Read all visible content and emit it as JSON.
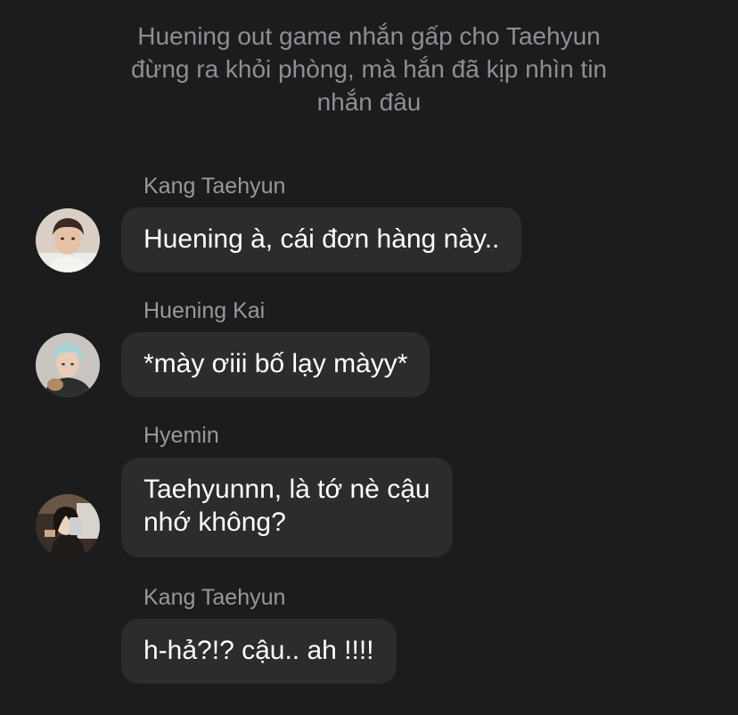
{
  "system_note": {
    "lines": [
      "Huening out game nhắn gấp cho Taehyun",
      "đừng ra khỏi phòng, mà hắn đã kịp nhìn tin",
      "nhắn đâu"
    ]
  },
  "messages": [
    {
      "sender": "Kang Taehyun",
      "avatar": "avatar-kang-taehyun",
      "lines": [
        "Huening à, cái đơn hàng này.."
      ]
    },
    {
      "sender": "Huening Kai",
      "avatar": "avatar-huening-kai",
      "lines": [
        "*mày ơiii bố lạy màyy*"
      ]
    },
    {
      "sender": "Hyemin",
      "avatar": "avatar-hyemin",
      "lines": [
        "Taehyunnn, là tớ nè cậu",
        "nhớ không?"
      ]
    },
    {
      "sender": "Kang Taehyun",
      "avatar": "none",
      "lines": [
        "h-hả?!? cậu.. ah !!!!"
      ]
    }
  ],
  "colors": {
    "background": "#1c1c1e",
    "bubble": "#2c2c2e",
    "sender_name": "#98989d",
    "system_note": "#8e8e93",
    "message_text": "#ffffff"
  }
}
